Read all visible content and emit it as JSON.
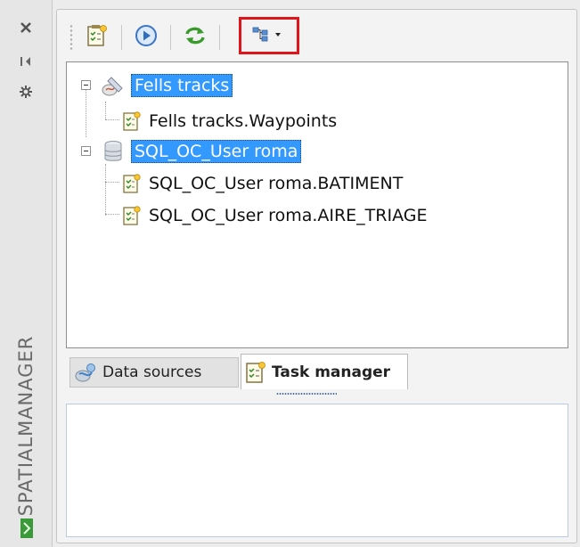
{
  "sidebar": {
    "title": "SPATIALMANAGER",
    "tools": [
      {
        "icon": "close-icon"
      },
      {
        "icon": "pin-icon"
      },
      {
        "icon": "settings-icon"
      }
    ],
    "logo_icon": "spatialmanager-logo-icon"
  },
  "toolbar": {
    "buttons": [
      {
        "icon": "new-task-icon"
      },
      {
        "icon": "run-icon"
      },
      {
        "icon": "refresh-icon"
      },
      {
        "icon": "tree-view-dropdown-icon"
      }
    ],
    "highlight_color": "#e0141b"
  },
  "tree": {
    "nodes": [
      {
        "label": "Fells tracks",
        "icon": "gpx-source-icon",
        "selected": true,
        "level": 0
      },
      {
        "label": "Fells tracks.Waypoints",
        "icon": "task-icon",
        "selected": false,
        "level": 1
      },
      {
        "label": "SQL_OC_User roma",
        "icon": "database-icon",
        "selected": true,
        "level": 0
      },
      {
        "label": "SQL_OC_User roma.BATIMENT",
        "icon": "task-icon",
        "selected": false,
        "level": 1
      },
      {
        "label": "SQL_OC_User roma.AIRE_TRIAGE",
        "icon": "task-icon",
        "selected": false,
        "level": 1
      }
    ],
    "selection_color": "#3399ff"
  },
  "tabs": [
    {
      "label": "Data sources",
      "icon": "data-sources-icon",
      "active": false
    },
    {
      "label": "Task manager",
      "icon": "task-manager-icon",
      "active": true
    }
  ]
}
